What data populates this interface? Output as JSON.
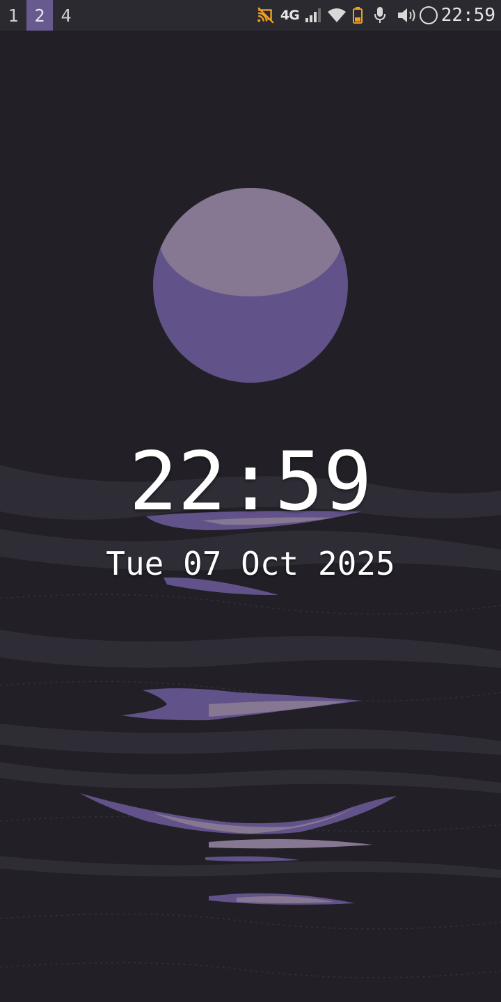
{
  "status_bar": {
    "workspaces": [
      {
        "label": "1",
        "active": false
      },
      {
        "label": "2",
        "active": true
      },
      {
        "label": "4",
        "active": false
      }
    ],
    "network_type": "4G",
    "time": "22:59",
    "icons": [
      "cast-off-icon",
      "network-type",
      "signal-icon",
      "wifi-icon",
      "battery-icon",
      "microphone-icon",
      "volume-icon",
      "circle-icon"
    ]
  },
  "lockscreen": {
    "time": "22:59",
    "date": "Tue 07 Oct 2025"
  },
  "colors": {
    "background": "#222026",
    "accent": "#665a8e",
    "moon_dark": "#62528a",
    "moon_light": "#867792",
    "warning": "#f0a020"
  }
}
